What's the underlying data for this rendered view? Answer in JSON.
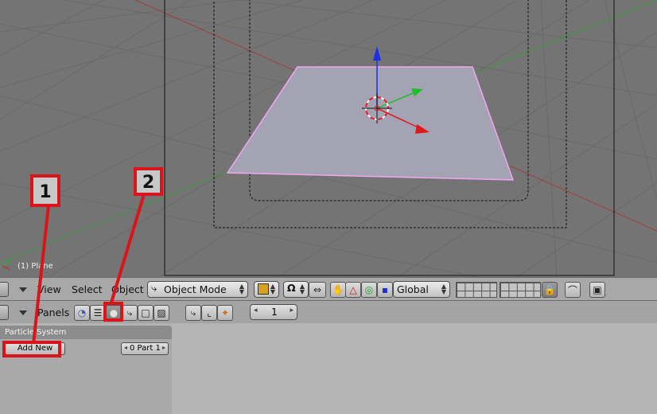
{
  "viewport": {
    "object_label": "(1) Plane"
  },
  "header1": {
    "menu": {
      "view": "View",
      "select": "Select",
      "object": "Object"
    },
    "mode_select": "Object Mode",
    "orientation_select": "Global"
  },
  "header2": {
    "panels_label": "Panels",
    "frame_number": "1"
  },
  "particle_panel": {
    "title": "Particle System",
    "add_new_label": "Add New",
    "part_label": "0 Part 1"
  },
  "callouts": [
    {
      "number": "1"
    },
    {
      "number": "2"
    }
  ],
  "colors": {
    "viewport_bg": "#747474",
    "plane_face": "#a3a3b4",
    "plane_outline": "#f2a6f2",
    "callout_red": "#d9141b",
    "z_axis": "#1c2ee8",
    "y_axis": "#1dbf2a",
    "x_axis": "#e01818"
  }
}
